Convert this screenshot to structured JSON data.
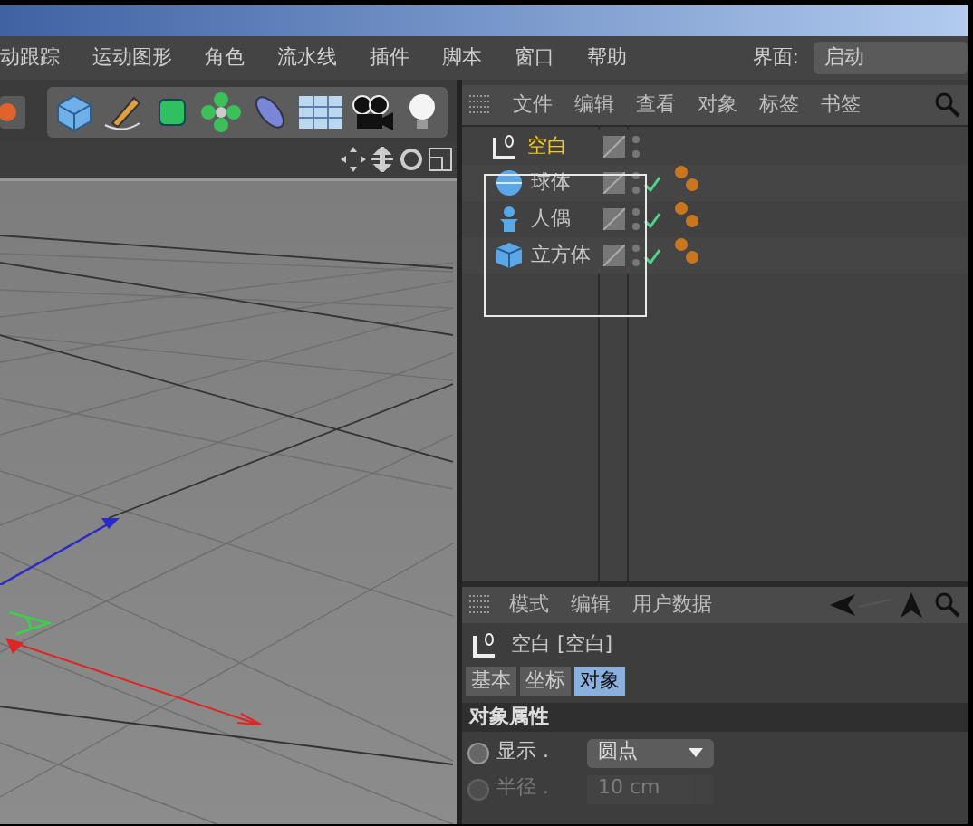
{
  "menu_bar": {
    "items": [
      "动跟踪",
      "运动图形",
      "角色",
      "流水线",
      "插件",
      "脚本",
      "窗口",
      "帮助"
    ],
    "layout_label": "界面:",
    "layout_value": "启动"
  },
  "object_manager": {
    "menu": [
      "文件",
      "编辑",
      "查看",
      "对象",
      "标签",
      "书签"
    ],
    "objects": [
      {
        "name": "空白",
        "kind": "null",
        "selected": true,
        "enabled": false,
        "phong_tag": false,
        "children": [
          {
            "name": "球体",
            "kind": "sphere",
            "selected": false,
            "enabled": true,
            "phong_tag": true
          },
          {
            "name": "人偶",
            "kind": "figure",
            "selected": false,
            "enabled": true,
            "phong_tag": true
          },
          {
            "name": "立方体",
            "kind": "cube",
            "selected": false,
            "enabled": true,
            "phong_tag": true
          }
        ]
      }
    ]
  },
  "attribute_manager": {
    "menu": [
      "模式",
      "编辑",
      "用户数据"
    ],
    "title": "空白 [空白]",
    "tabs": [
      {
        "label": "基本",
        "selected": false
      },
      {
        "label": "坐标",
        "selected": false
      },
      {
        "label": "对象",
        "selected": true
      }
    ],
    "section": "对象属性",
    "fields": [
      {
        "label": "显示 .",
        "kind": "dropdown",
        "value": "圆点",
        "disabled": false
      },
      {
        "label": "半径 .",
        "kind": "number",
        "value": "10 cm",
        "disabled": true
      }
    ]
  }
}
